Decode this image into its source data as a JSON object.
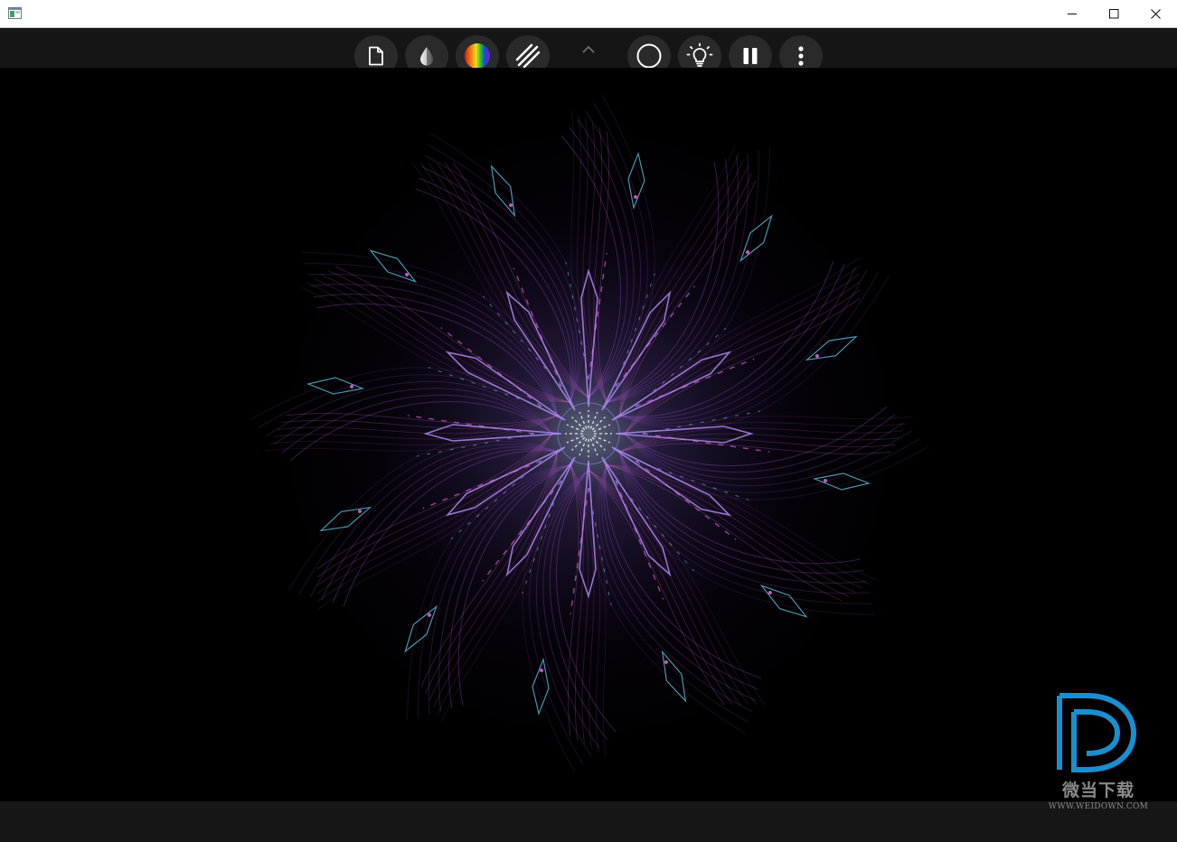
{
  "window": {
    "title_icon": "app-window-icon",
    "controls": [
      "minimize-icon",
      "maximize-icon",
      "close-icon"
    ]
  },
  "toolbar": {
    "buttons": [
      {
        "name": "new-canvas-button",
        "icon": "page-icon"
      },
      {
        "name": "ink-drop-button",
        "icon": "drop-icon"
      },
      {
        "name": "color-palette-button",
        "icon": "gradient-circle-icon"
      },
      {
        "name": "line-style-button",
        "icon": "diagonal-lines-icon"
      },
      {
        "name": "collapse-toolbar-button",
        "icon": "chevron-up-icon"
      },
      {
        "name": "brush-shape-button",
        "icon": "circle-outline-icon"
      },
      {
        "name": "glow-button",
        "icon": "lightbulb-icon"
      },
      {
        "name": "pause-button",
        "icon": "pause-icon"
      },
      {
        "name": "more-options-button",
        "icon": "vertical-ellipsis-icon"
      }
    ]
  },
  "canvas": {
    "symmetry": 12,
    "colors": {
      "primary": "#a050d8",
      "accent": "#d860d0",
      "highlight": "#60c8e8"
    }
  },
  "watermark": {
    "title": "微当下载",
    "url": "WWW.WEIDOWN.COM",
    "logo_color": "#1a8fd0"
  }
}
